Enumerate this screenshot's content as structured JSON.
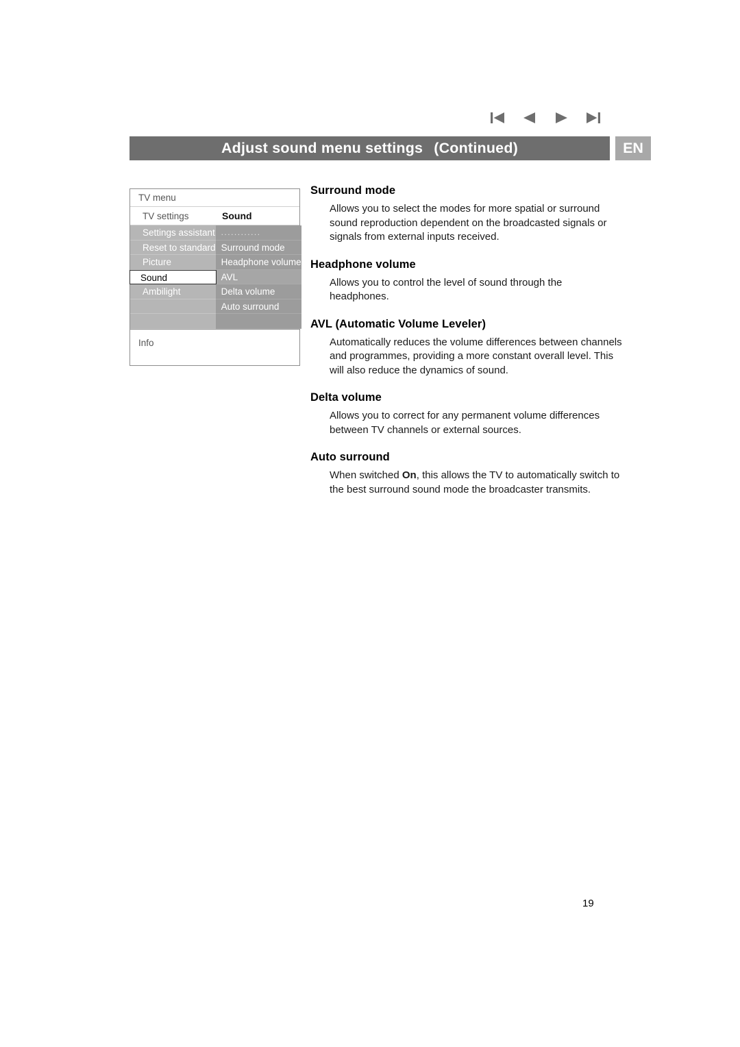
{
  "header": {
    "title": "Adjust sound menu settings",
    "continued": "(Continued)",
    "language_badge": "EN",
    "nav_icons": [
      "first-page-icon",
      "previous-page-icon",
      "next-page-icon",
      "last-page-icon"
    ]
  },
  "tv_menu": {
    "title": "TV menu",
    "submenu_label": "TV settings",
    "panel_title": "Sound",
    "info_label": "Info",
    "left_items": [
      {
        "label": "Settings assistant",
        "selected": false
      },
      {
        "label": "Reset to standard",
        "selected": false
      },
      {
        "label": "Picture",
        "selected": false
      },
      {
        "label": "Sound",
        "selected": true
      },
      {
        "label": "Ambilight",
        "selected": false
      },
      {
        "label": "",
        "selected": false
      },
      {
        "label": "",
        "selected": false
      }
    ],
    "right_items": [
      {
        "label": "............",
        "highlight": false,
        "dots": true
      },
      {
        "label": "Surround mode",
        "highlight": false,
        "dots": false
      },
      {
        "label": "Headphone volume",
        "highlight": false,
        "dots": false
      },
      {
        "label": "AVL",
        "highlight": true,
        "dots": false
      },
      {
        "label": "Delta volume",
        "highlight": false,
        "dots": false
      },
      {
        "label": "Auto surround",
        "highlight": false,
        "dots": false
      },
      {
        "label": "",
        "highlight": false,
        "dots": false
      }
    ]
  },
  "sections": [
    {
      "heading": "Surround mode",
      "body": "Allows you to select the modes for more spatial or surround sound reproduction dependent on the broadcasted signals or signals from external inputs received."
    },
    {
      "heading": "Headphone volume",
      "body": "Allows you to control the level of sound through the headphones."
    },
    {
      "heading": "AVL (Automatic Volume Leveler)",
      "body": "Automatically reduces the volume differences between channels and programmes, providing a more constant overall level. This will also reduce the dynamics of sound."
    },
    {
      "heading": "Delta volume",
      "body": "Allows you to correct for any permanent volume differences between TV channels or external sources."
    },
    {
      "heading": "Auto surround",
      "body_prefix": "When switched ",
      "body_bold": "On",
      "body_suffix": ", this allows the TV to automatically switch to the best surround sound mode the broadcaster transmits."
    }
  ],
  "footer": {
    "page_number": "19"
  },
  "colors": {
    "title_bar": "#6e6e6e",
    "language_badge": "#a8a8a8",
    "menu_left_column": "#b6b6b6",
    "menu_right_column": "#9c9c9c"
  }
}
